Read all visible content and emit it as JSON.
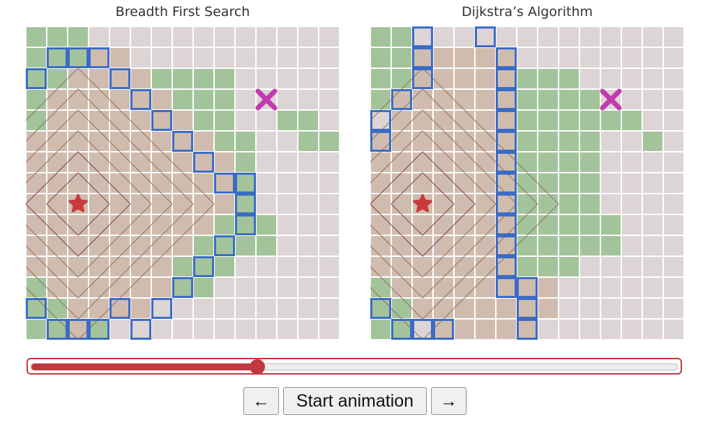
{
  "panels": {
    "left": {
      "title": "Breadth First Search"
    },
    "right": {
      "title": "Dijkstra’s Algorithm"
    }
  },
  "grid": {
    "cols": 15,
    "rows": 15,
    "start_cell": [
      2,
      8
    ],
    "goal_cell": [
      11,
      3
    ],
    "left_grass": [
      [
        0,
        0
      ],
      [
        1,
        0
      ],
      [
        2,
        0
      ],
      [
        0,
        1
      ],
      [
        1,
        1
      ],
      [
        2,
        1
      ],
      [
        3,
        1
      ],
      [
        4,
        1
      ],
      [
        0,
        2
      ],
      [
        1,
        2
      ],
      [
        5,
        2
      ],
      [
        6,
        2
      ],
      [
        7,
        2
      ],
      [
        8,
        2
      ],
      [
        9,
        2
      ],
      [
        0,
        3
      ],
      [
        1,
        3
      ],
      [
        5,
        3
      ],
      [
        6,
        3
      ],
      [
        7,
        3
      ],
      [
        8,
        3
      ],
      [
        9,
        3
      ],
      [
        0,
        4
      ],
      [
        1,
        4
      ],
      [
        6,
        4
      ],
      [
        7,
        4
      ],
      [
        8,
        4
      ],
      [
        9,
        4
      ],
      [
        12,
        4
      ],
      [
        13,
        4
      ],
      [
        0,
        5
      ],
      [
        1,
        5
      ],
      [
        6,
        5
      ],
      [
        7,
        5
      ],
      [
        8,
        5
      ],
      [
        9,
        5
      ],
      [
        10,
        5
      ],
      [
        13,
        5
      ],
      [
        7,
        6
      ],
      [
        8,
        6
      ],
      [
        9,
        6
      ],
      [
        10,
        6
      ],
      [
        14,
        5
      ],
      [
        7,
        7
      ],
      [
        8,
        7
      ],
      [
        9,
        7
      ],
      [
        10,
        7
      ],
      [
        7,
        8
      ],
      [
        8,
        8
      ],
      [
        9,
        8
      ],
      [
        10,
        8
      ],
      [
        7,
        9
      ],
      [
        8,
        9
      ],
      [
        9,
        9
      ],
      [
        10,
        9
      ],
      [
        11,
        9
      ],
      [
        7,
        10
      ],
      [
        8,
        10
      ],
      [
        9,
        10
      ],
      [
        10,
        10
      ],
      [
        11,
        10
      ],
      [
        6,
        11
      ],
      [
        7,
        11
      ],
      [
        8,
        11
      ],
      [
        9,
        11
      ],
      [
        6,
        12
      ],
      [
        7,
        12
      ],
      [
        8,
        12
      ],
      [
        0,
        12
      ],
      [
        1,
        12
      ],
      [
        0,
        13
      ],
      [
        1,
        13
      ],
      [
        2,
        13
      ],
      [
        3,
        13
      ],
      [
        0,
        14
      ],
      [
        1,
        14
      ],
      [
        2,
        14
      ],
      [
        3,
        14
      ]
    ],
    "left_visited": [
      [
        3,
        1
      ],
      [
        4,
        1
      ],
      [
        2,
        2
      ],
      [
        3,
        2
      ],
      [
        4,
        2
      ],
      [
        5,
        2
      ],
      [
        1,
        3
      ],
      [
        2,
        3
      ],
      [
        3,
        3
      ],
      [
        4,
        3
      ],
      [
        5,
        3
      ],
      [
        6,
        3
      ],
      [
        1,
        4
      ],
      [
        2,
        4
      ],
      [
        3,
        4
      ],
      [
        4,
        4
      ],
      [
        5,
        4
      ],
      [
        6,
        4
      ],
      [
        7,
        4
      ],
      [
        0,
        5
      ],
      [
        1,
        5
      ],
      [
        2,
        5
      ],
      [
        3,
        5
      ],
      [
        4,
        5
      ],
      [
        5,
        5
      ],
      [
        6,
        5
      ],
      [
        7,
        5
      ],
      [
        8,
        5
      ],
      [
        0,
        6
      ],
      [
        1,
        6
      ],
      [
        2,
        6
      ],
      [
        3,
        6
      ],
      [
        4,
        6
      ],
      [
        5,
        6
      ],
      [
        6,
        6
      ],
      [
        7,
        6
      ],
      [
        8,
        6
      ],
      [
        9,
        6
      ],
      [
        0,
        7
      ],
      [
        1,
        7
      ],
      [
        2,
        7
      ],
      [
        3,
        7
      ],
      [
        4,
        7
      ],
      [
        5,
        7
      ],
      [
        6,
        7
      ],
      [
        7,
        7
      ],
      [
        8,
        7
      ],
      [
        9,
        7
      ],
      [
        0,
        8
      ],
      [
        1,
        8
      ],
      [
        2,
        8
      ],
      [
        3,
        8
      ],
      [
        4,
        8
      ],
      [
        5,
        8
      ],
      [
        6,
        8
      ],
      [
        7,
        8
      ],
      [
        8,
        8
      ],
      [
        9,
        8
      ],
      [
        0,
        9
      ],
      [
        1,
        9
      ],
      [
        2,
        9
      ],
      [
        3,
        9
      ],
      [
        4,
        9
      ],
      [
        5,
        9
      ],
      [
        6,
        9
      ],
      [
        7,
        9
      ],
      [
        8,
        9
      ],
      [
        0,
        10
      ],
      [
        1,
        10
      ],
      [
        2,
        10
      ],
      [
        3,
        10
      ],
      [
        4,
        10
      ],
      [
        5,
        10
      ],
      [
        6,
        10
      ],
      [
        7,
        10
      ],
      [
        0,
        11
      ],
      [
        1,
        11
      ],
      [
        2,
        11
      ],
      [
        3,
        11
      ],
      [
        4,
        11
      ],
      [
        5,
        11
      ],
      [
        6,
        11
      ],
      [
        1,
        12
      ],
      [
        2,
        12
      ],
      [
        3,
        12
      ],
      [
        4,
        12
      ],
      [
        5,
        12
      ],
      [
        6,
        12
      ],
      [
        2,
        13
      ],
      [
        3,
        13
      ],
      [
        4,
        13
      ],
      [
        5,
        13
      ],
      [
        2,
        14
      ]
    ],
    "left_frontier": [
      [
        1,
        1
      ],
      [
        2,
        1
      ],
      [
        3,
        1
      ],
      [
        0,
        2
      ],
      [
        4,
        2
      ],
      [
        5,
        3
      ],
      [
        6,
        4
      ],
      [
        7,
        5
      ],
      [
        8,
        6
      ],
      [
        9,
        7
      ],
      [
        10,
        7
      ],
      [
        10,
        8
      ],
      [
        10,
        9
      ],
      [
        9,
        10
      ],
      [
        8,
        11
      ],
      [
        7,
        12
      ],
      [
        6,
        13
      ],
      [
        5,
        14
      ],
      [
        4,
        13
      ],
      [
        0,
        13
      ],
      [
        1,
        14
      ],
      [
        2,
        14
      ],
      [
        3,
        14
      ]
    ],
    "right_grass": [
      [
        0,
        0
      ],
      [
        1,
        0
      ],
      [
        0,
        1
      ],
      [
        1,
        1
      ],
      [
        0,
        2
      ],
      [
        1,
        2
      ],
      [
        7,
        2
      ],
      [
        8,
        2
      ],
      [
        9,
        2
      ],
      [
        0,
        3
      ],
      [
        7,
        3
      ],
      [
        8,
        3
      ],
      [
        9,
        3
      ],
      [
        10,
        3
      ],
      [
        11,
        4
      ],
      [
        12,
        4
      ],
      [
        7,
        4
      ],
      [
        8,
        4
      ],
      [
        9,
        4
      ],
      [
        10,
        4
      ],
      [
        13,
        5
      ],
      [
        7,
        5
      ],
      [
        8,
        5
      ],
      [
        9,
        5
      ],
      [
        10,
        5
      ],
      [
        7,
        6
      ],
      [
        8,
        6
      ],
      [
        9,
        6
      ],
      [
        10,
        6
      ],
      [
        7,
        7
      ],
      [
        8,
        7
      ],
      [
        9,
        7
      ],
      [
        10,
        7
      ],
      [
        7,
        8
      ],
      [
        8,
        8
      ],
      [
        9,
        8
      ],
      [
        10,
        8
      ],
      [
        7,
        9
      ],
      [
        8,
        9
      ],
      [
        9,
        9
      ],
      [
        10,
        9
      ],
      [
        11,
        9
      ],
      [
        7,
        10
      ],
      [
        8,
        10
      ],
      [
        9,
        10
      ],
      [
        10,
        10
      ],
      [
        11,
        10
      ],
      [
        7,
        11
      ],
      [
        8,
        11
      ],
      [
        9,
        11
      ],
      [
        7,
        12
      ],
      [
        8,
        12
      ],
      [
        0,
        12
      ],
      [
        1,
        12
      ],
      [
        2,
        12
      ],
      [
        3,
        12
      ],
      [
        0,
        13
      ],
      [
        1,
        13
      ],
      [
        0,
        14
      ],
      [
        1,
        14
      ]
    ],
    "right_visited": [
      [
        2,
        1
      ],
      [
        3,
        1
      ],
      [
        4,
        1
      ],
      [
        5,
        1
      ],
      [
        6,
        1
      ],
      [
        2,
        2
      ],
      [
        3,
        2
      ],
      [
        4,
        2
      ],
      [
        5,
        2
      ],
      [
        6,
        2
      ],
      [
        1,
        3
      ],
      [
        2,
        3
      ],
      [
        3,
        3
      ],
      [
        4,
        3
      ],
      [
        5,
        3
      ],
      [
        6,
        3
      ],
      [
        1,
        4
      ],
      [
        2,
        4
      ],
      [
        3,
        4
      ],
      [
        4,
        4
      ],
      [
        5,
        4
      ],
      [
        6,
        4
      ],
      [
        0,
        5
      ],
      [
        1,
        5
      ],
      [
        2,
        5
      ],
      [
        3,
        5
      ],
      [
        4,
        5
      ],
      [
        5,
        5
      ],
      [
        6,
        5
      ],
      [
        0,
        6
      ],
      [
        1,
        6
      ],
      [
        2,
        6
      ],
      [
        3,
        6
      ],
      [
        4,
        6
      ],
      [
        5,
        6
      ],
      [
        6,
        6
      ],
      [
        0,
        7
      ],
      [
        1,
        7
      ],
      [
        2,
        7
      ],
      [
        3,
        7
      ],
      [
        4,
        7
      ],
      [
        5,
        7
      ],
      [
        6,
        7
      ],
      [
        0,
        8
      ],
      [
        1,
        8
      ],
      [
        2,
        8
      ],
      [
        3,
        8
      ],
      [
        4,
        8
      ],
      [
        5,
        8
      ],
      [
        6,
        8
      ],
      [
        0,
        9
      ],
      [
        1,
        9
      ],
      [
        2,
        9
      ],
      [
        3,
        9
      ],
      [
        4,
        9
      ],
      [
        5,
        9
      ],
      [
        6,
        9
      ],
      [
        0,
        10
      ],
      [
        1,
        10
      ],
      [
        2,
        10
      ],
      [
        3,
        10
      ],
      [
        4,
        10
      ],
      [
        5,
        10
      ],
      [
        6,
        10
      ],
      [
        0,
        11
      ],
      [
        1,
        11
      ],
      [
        2,
        11
      ],
      [
        3,
        11
      ],
      [
        4,
        11
      ],
      [
        5,
        11
      ],
      [
        6,
        11
      ],
      [
        1,
        12
      ],
      [
        2,
        12
      ],
      [
        3,
        12
      ],
      [
        4,
        12
      ],
      [
        5,
        12
      ],
      [
        6,
        12
      ],
      [
        7,
        12
      ],
      [
        8,
        12
      ],
      [
        2,
        13
      ],
      [
        3,
        13
      ],
      [
        4,
        13
      ],
      [
        5,
        13
      ],
      [
        6,
        13
      ],
      [
        7,
        13
      ],
      [
        8,
        13
      ],
      [
        3,
        14
      ],
      [
        4,
        14
      ],
      [
        5,
        14
      ],
      [
        6,
        14
      ],
      [
        7,
        14
      ]
    ],
    "right_frontier": [
      [
        2,
        0
      ],
      [
        5,
        0
      ],
      [
        2,
        1
      ],
      [
        6,
        1
      ],
      [
        2,
        2
      ],
      [
        1,
        3
      ],
      [
        0,
        4
      ],
      [
        0,
        5
      ],
      [
        6,
        2
      ],
      [
        6,
        3
      ],
      [
        6,
        4
      ],
      [
        6,
        5
      ],
      [
        6,
        6
      ],
      [
        6,
        7
      ],
      [
        6,
        8
      ],
      [
        6,
        9
      ],
      [
        6,
        10
      ],
      [
        6,
        11
      ],
      [
        6,
        12
      ],
      [
        7,
        12
      ],
      [
        7,
        13
      ],
      [
        7,
        14
      ],
      [
        0,
        13
      ],
      [
        1,
        14
      ],
      [
        2,
        14
      ],
      [
        3,
        14
      ]
    ],
    "colors": {
      "empty": "#ddd4d6",
      "grass": "#a3c49a",
      "visited": "#d0bcae",
      "frontier": "#3a6cc7",
      "contour": "#8a6a55",
      "inner_contour": "#7a3045",
      "start": "#c83a3e",
      "goal": "#c03bb0"
    }
  },
  "slider": {
    "progress": 0.35
  },
  "controls": {
    "prev_label": "←",
    "start_label": "Start animation",
    "next_label": "→"
  }
}
